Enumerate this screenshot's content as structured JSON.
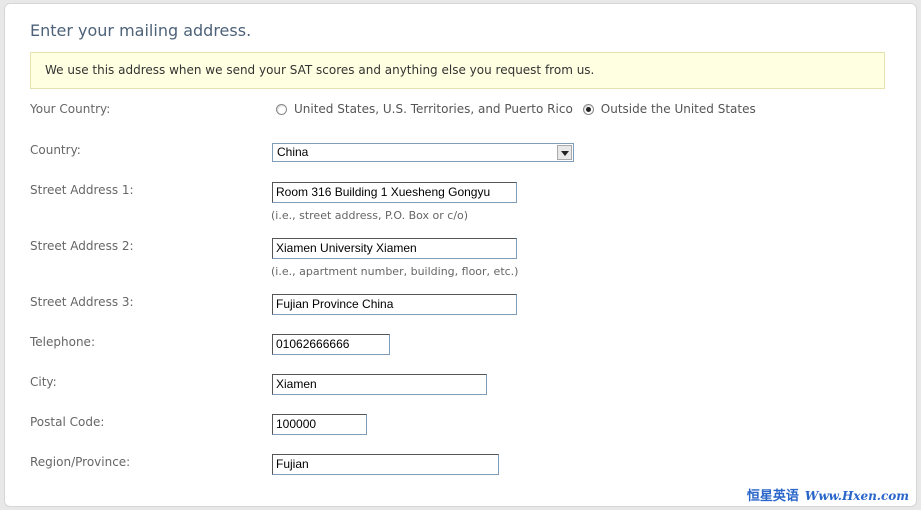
{
  "page": {
    "heading": "Enter your mailing address.",
    "notice": "We use this address when we send your SAT scores and anything else you request from us."
  },
  "country_choice": {
    "label": "Your Country:",
    "options": [
      {
        "label": "United States, U.S. Territories, and Puerto Rico",
        "checked": false
      },
      {
        "label": "Outside the United States",
        "checked": true
      }
    ]
  },
  "country": {
    "label": "Country:",
    "value": "China"
  },
  "street1": {
    "label": "Street Address 1:",
    "value": "Room 316 Building 1 Xuesheng Gongyu",
    "hint": "(i.e., street address, P.O. Box or c/o)"
  },
  "street2": {
    "label": "Street Address 2:",
    "value": "Xiamen University Xiamen",
    "hint": "(i.e., apartment number, building, floor, etc.)"
  },
  "street3": {
    "label": "Street Address 3:",
    "value": "Fujian Province China"
  },
  "telephone": {
    "label": "Telephone:",
    "value": "01062666666"
  },
  "city": {
    "label": "City:",
    "value": "Xiamen"
  },
  "postal": {
    "label": "Postal Code:",
    "value": "100000"
  },
  "region": {
    "label": "Region/Province:",
    "value": "Fujian"
  },
  "watermark": {
    "brand": "恒星英语",
    "url": "Www.Hxen.com"
  }
}
